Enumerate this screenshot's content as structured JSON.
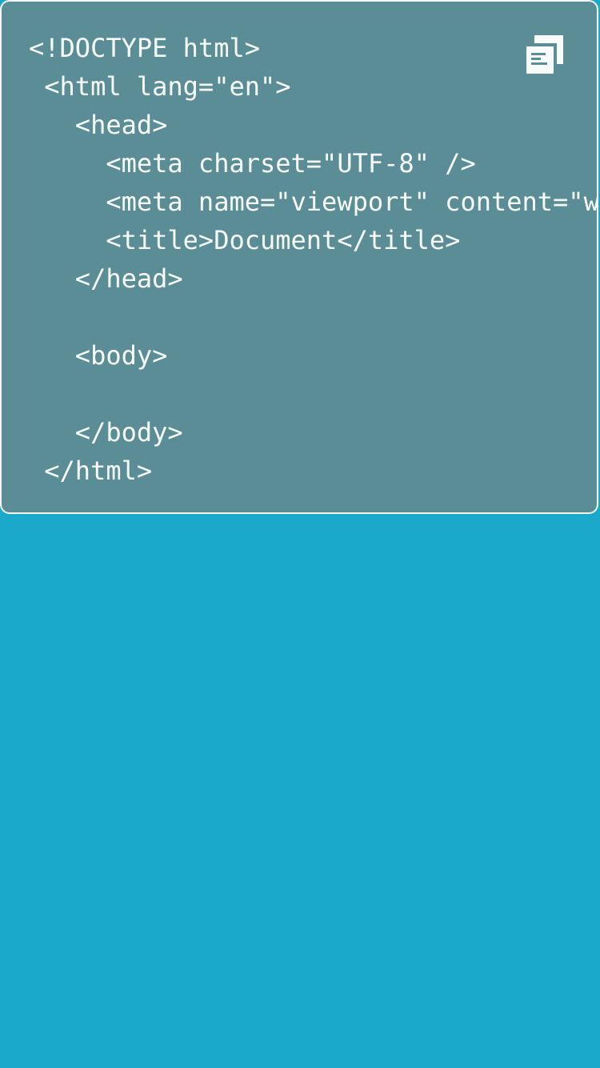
{
  "code_card": {
    "lines": [
      "<!DOCTYPE html>",
      " <html lang=\"en\">",
      "   <head>",
      "     <meta charset=\"UTF-8\" />",
      "     <meta name=\"viewport\" content=\"width",
      "     <title>Document</title>",
      "   </head>",
      "",
      "   <body>",
      "",
      "   </body>",
      " </html>"
    ],
    "copy_icon": "copy-icon"
  },
  "colors": {
    "page_background": "#1aa9cb",
    "card_background": "#5a8d95",
    "text": "#f8fbfc",
    "card_border": "#f3f7f8"
  }
}
